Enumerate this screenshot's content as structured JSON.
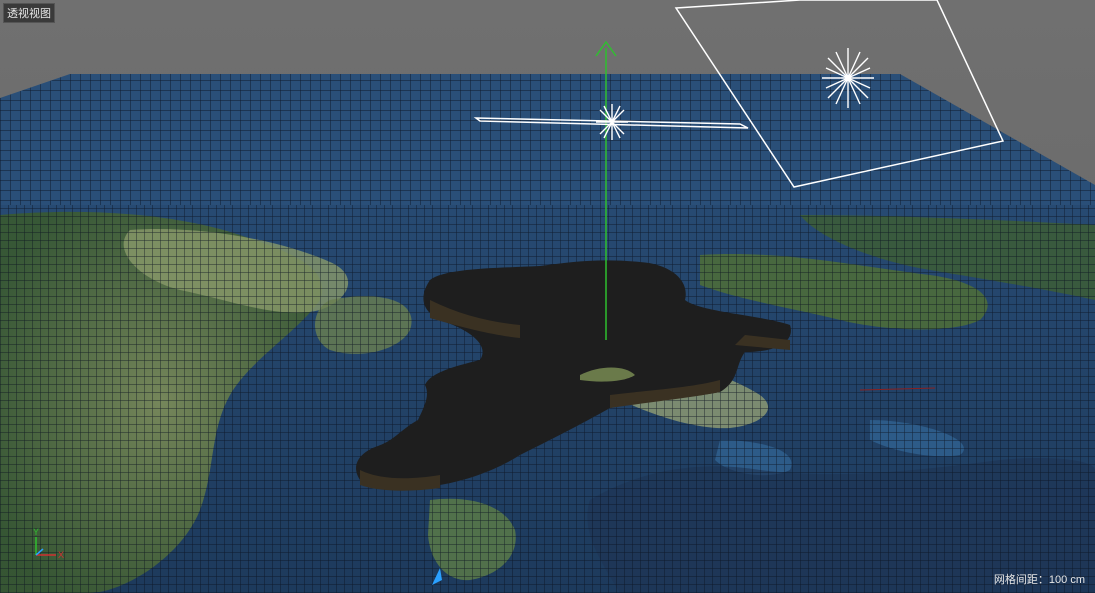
{
  "viewport": {
    "view_label": "透视视图",
    "grid_spacing_label": "网格间距：100 cm"
  },
  "axis_gizmo": {
    "y_label": "Y",
    "x_label": "X"
  },
  "colors": {
    "background_gray": "#6b6b6b",
    "grid_blue": "#2a4f78",
    "ground_green": "#4a6b3a",
    "extrusion_dark": "#1f1f1f",
    "gizmo_green": "#2fbf2f",
    "light_white": "#ffffff",
    "axis_red": "#d03030",
    "axis_blue": "#2aa0ff"
  },
  "icons": {
    "light_star": "asterisk-light-icon",
    "y_axis_arrow": "green-up-arrow-icon"
  }
}
